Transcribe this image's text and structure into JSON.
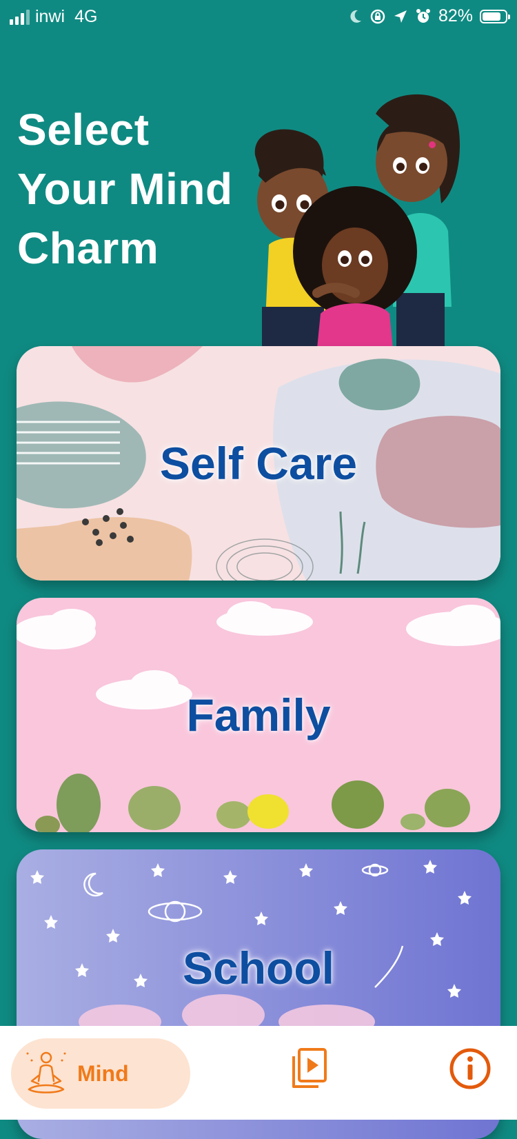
{
  "status_bar": {
    "carrier": "inwi",
    "network": "4G",
    "battery": "82%",
    "battery_level": 0.82
  },
  "header": {
    "title_line1": "Select",
    "title_line2": "Your Mind",
    "title_line3": "Charm"
  },
  "categories": [
    {
      "label": "Self Care"
    },
    {
      "label": "Family"
    },
    {
      "label": "School"
    }
  ],
  "tabbar": {
    "mind_label": "Mind",
    "active_color": "#f07a1a"
  },
  "colors": {
    "background": "#0f8a82",
    "card_text": "#0d4ea0",
    "accent": "#f07a1a"
  }
}
